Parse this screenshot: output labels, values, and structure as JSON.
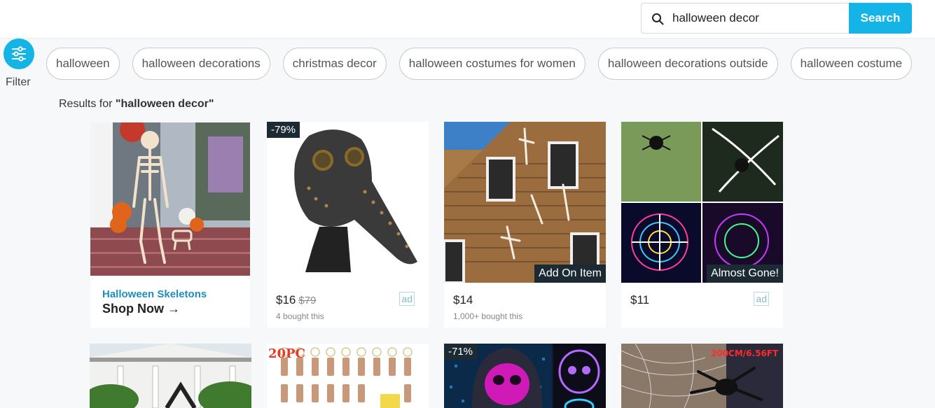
{
  "search": {
    "value": "halloween decor",
    "button_label": "Search"
  },
  "filter": {
    "label": "Filter"
  },
  "chips": [
    "halloween",
    "halloween decorations",
    "christmas decor",
    "halloween costumes for women",
    "halloween decorations outside",
    "halloween costume"
  ],
  "results": {
    "prefix": "Results for ",
    "query": "\"halloween decor\""
  },
  "products": [
    {
      "type": "promo",
      "category": "Halloween Skeletons",
      "cta": "Shop Now →"
    },
    {
      "badge": "-79%",
      "price": "$16",
      "old_price": "$79",
      "bought": "4 bought this",
      "ad": "ad"
    },
    {
      "label": "Add On Item",
      "price": "$14",
      "bought": "1,000+ bought this"
    },
    {
      "label": "Almost Gone!",
      "price": "$11",
      "ad": "ad"
    }
  ],
  "row2": [
    {
      "overlay": ""
    },
    {
      "overlay": "20PC"
    },
    {
      "badge": "-71%"
    },
    {
      "overlay": "200CM/6.56FT"
    }
  ],
  "colors": {
    "accent": "#14b4e6",
    "badge_bg": "#1c2b33",
    "link_blue": "#1a8fc0"
  }
}
